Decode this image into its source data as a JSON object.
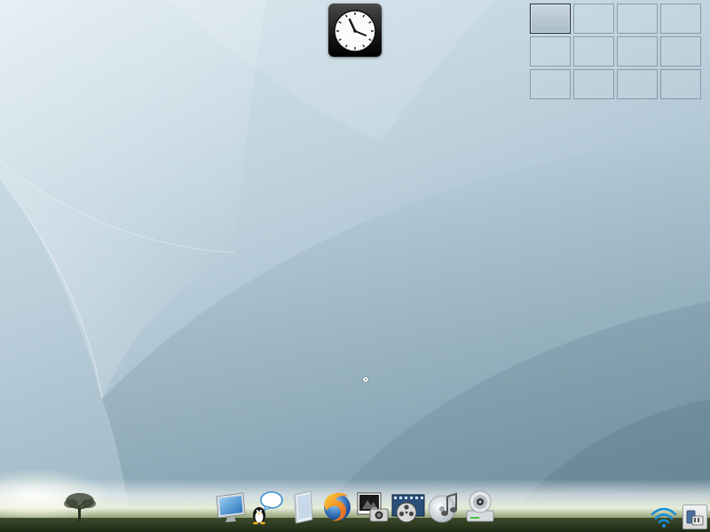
{
  "desktop": {
    "wallpaper": "abstract-curves",
    "accent_color": "#a9bcc7"
  },
  "clock": {
    "icon": "analog-clock-icon",
    "time": "10:08"
  },
  "pager": {
    "rows": 3,
    "columns": 4,
    "active_index": 0
  },
  "dock": {
    "items": [
      {
        "name": "computer-monitor-icon"
      },
      {
        "name": "penguin-chat-icon"
      },
      {
        "name": "file-manager-icon"
      },
      {
        "name": "firefox-browser-icon"
      },
      {
        "name": "photo-camera-icon"
      },
      {
        "name": "film-reel-icon"
      },
      {
        "name": "music-note-icon"
      },
      {
        "name": "dvd-drive-icon"
      }
    ]
  },
  "tray": {
    "items": [
      {
        "name": "wifi-icon"
      },
      {
        "name": "device-manager-icon"
      }
    ]
  }
}
